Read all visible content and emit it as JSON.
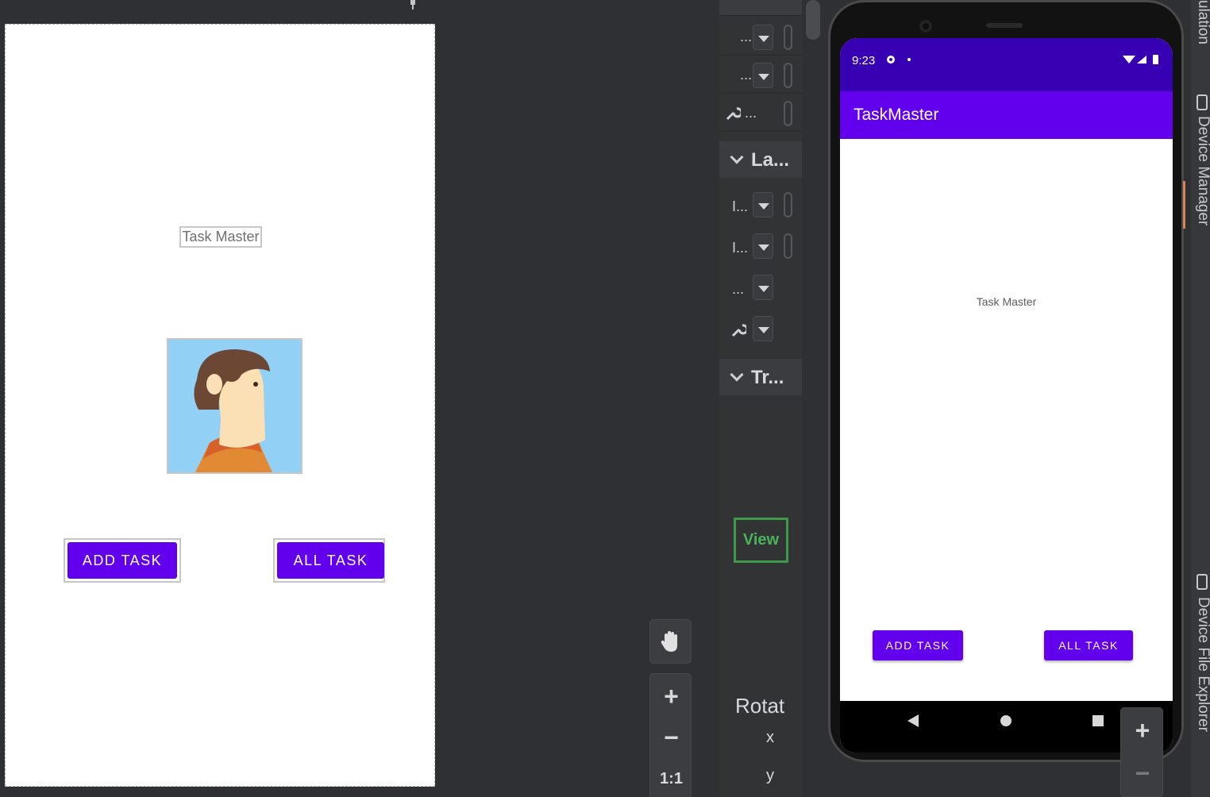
{
  "design": {
    "title_text": "Task Master",
    "add_button": "ADD TASK",
    "all_button": "ALL TASK"
  },
  "attributes": {
    "rows_top": [
      "...",
      "...",
      "..."
    ],
    "layout_section": "La...",
    "layout_rows": [
      "I...",
      "I...",
      "..."
    ],
    "transforms_section": "Tr...",
    "view_badge": "View",
    "rotation_label": "Rotat",
    "axis_x": "x",
    "axis_y": "y"
  },
  "zoom": {
    "plus": "+",
    "minus": "−",
    "actual": "1:1"
  },
  "phone": {
    "time": "9:23",
    "app_title": "TaskMaster",
    "body_title": "Task Master",
    "add_button": "ADD TASK",
    "all_button": "ALL TASK"
  },
  "side_tools": {
    "top_fragment": "ulation",
    "device_manager": "Device Manager",
    "device_file_explorer": "Device File Explorer"
  },
  "colors": {
    "primary": "#6200ee",
    "primary_dark": "#3700b3",
    "view_badge": "#3d9a47"
  }
}
